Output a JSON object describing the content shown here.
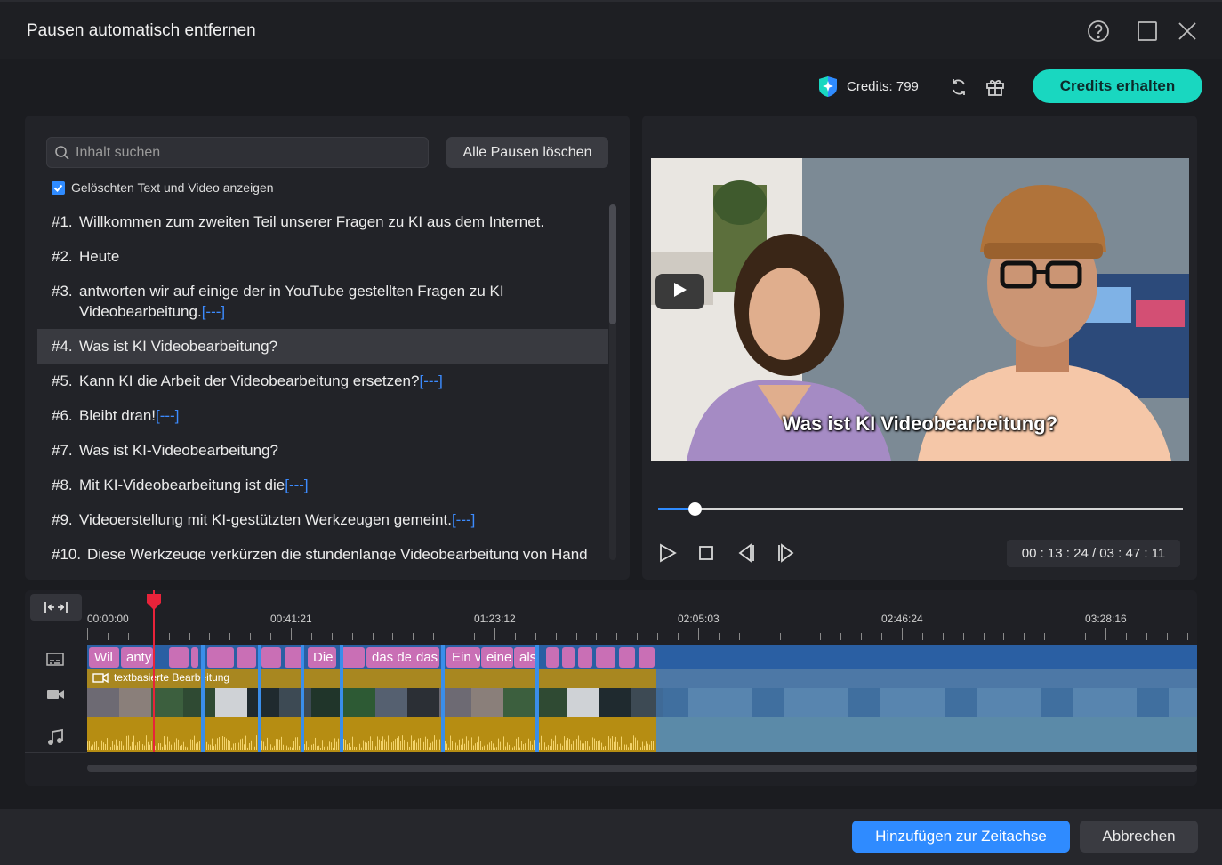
{
  "dialog": {
    "title": "Pausen automatisch entfernen",
    "help_icon": "help-icon",
    "maximize_icon": "maximize-icon",
    "close_icon": "close-icon"
  },
  "credits": {
    "label": "Credits: 799",
    "get_button": "Credits erhalten",
    "accent": "#19d7c0"
  },
  "search": {
    "placeholder": "Inhalt suchen",
    "value": ""
  },
  "clear_pauses_button": "Alle Pausen löschen",
  "show_deleted": {
    "label": "Gelöschten Text und Video anzeigen",
    "checked": true
  },
  "transcript": [
    {
      "num": "#1.",
      "text": "Willkommen zum zweiten Teil unserer Fragen zu KI aus dem Internet.",
      "pause": ""
    },
    {
      "num": "#2.",
      "text": "Heute",
      "pause": ""
    },
    {
      "num": "#3.",
      "text": "antworten wir auf einige der in YouTube gestellten Fragen zu KI Videobearbeitung.",
      "pause": "[---]"
    },
    {
      "num": "#4.",
      "text": "Was ist KI Videobearbeitung?",
      "pause": "",
      "selected": true
    },
    {
      "num": "#5.",
      "text": "Kann KI die Arbeit der Videobearbeitung ersetzen?",
      "pause": "[---]"
    },
    {
      "num": "#6.",
      "text": "Bleibt dran!",
      "pause": "[---]"
    },
    {
      "num": "#7.",
      "text": "Was ist KI-Videobearbeitung?",
      "pause": ""
    },
    {
      "num": "#8.",
      "text": "Mit KI-Videobearbeitung ist die",
      "pause": "[---]"
    },
    {
      "num": "#9.",
      "text": "Videoerstellung mit KI-gestützten Werkzeugen gemeint.",
      "pause": "[---]"
    },
    {
      "num": "#10.",
      "text": "Diese Werkzeuge verkürzen die stundenlange Videobearbeitung von Hand",
      "pause": ""
    }
  ],
  "player": {
    "subtitle": "Was ist KI Videobearbeitung?",
    "progress": 0.07,
    "timecode": "00 : 13 : 24 / 03 : 47 : 11"
  },
  "timeline": {
    "ticks": [
      "00:00:00",
      "00:41:21",
      "01:23:12",
      "02:05:03",
      "02:46:24",
      "03:28:16"
    ],
    "video_track_label": "textbasierte Bearbeitung",
    "subtitle_segments": [
      "Wil",
      "anty",
      "Die",
      "das de",
      "das",
      "Ein v",
      "eine",
      "als"
    ]
  },
  "footer": {
    "add_button": "Hinzufügen zur Zeitachse",
    "cancel_button": "Abbrechen"
  }
}
